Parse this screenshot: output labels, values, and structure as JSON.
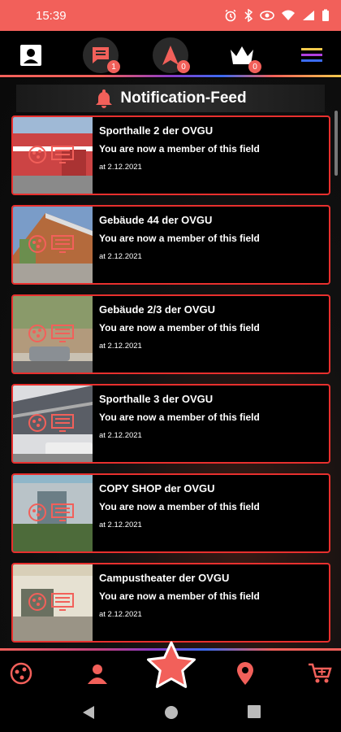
{
  "status": {
    "time": "15:39"
  },
  "topnav": {
    "chat_badge": "1",
    "compass_badge": "0",
    "crown_badge": "0"
  },
  "feed": {
    "title": "Notification-Feed",
    "items": [
      {
        "title": "Sporthalle 2 der OVGU",
        "message": "You are now a member of this field",
        "date": "at 2.12.2021"
      },
      {
        "title": "Gebäude 44 der OVGU",
        "message": "You are now a member of this field",
        "date": "at 2.12.2021"
      },
      {
        "title": "Gebäude 2/3 der OVGU",
        "message": "You are now a member of this field",
        "date": "at 2.12.2021"
      },
      {
        "title": "Sporthalle 3 der OVGU",
        "message": "You are now a member of this field",
        "date": "at 2.12.2021"
      },
      {
        "title": "COPY SHOP der OVGU",
        "message": "You are now a member of this field",
        "date": "at 2.12.2021"
      },
      {
        "title": "Campustheater der OVGU",
        "message": "You are now a member of this field",
        "date": "at 2.12.2021"
      }
    ]
  },
  "colors": {
    "accent": "#f2605a",
    "card_border": "#e8302e",
    "background": "#000000"
  },
  "icons": {
    "topnav": [
      "profile-card-icon",
      "chat-icon",
      "compass-arrow-icon",
      "crown-icon",
      "hamburger-menu-icon"
    ],
    "bottomnav": [
      "ball-icon",
      "person-icon",
      "star-icon",
      "map-pin-icon",
      "shopping-cart-icon"
    ],
    "android": [
      "back-icon",
      "home-icon",
      "recents-icon"
    ]
  }
}
